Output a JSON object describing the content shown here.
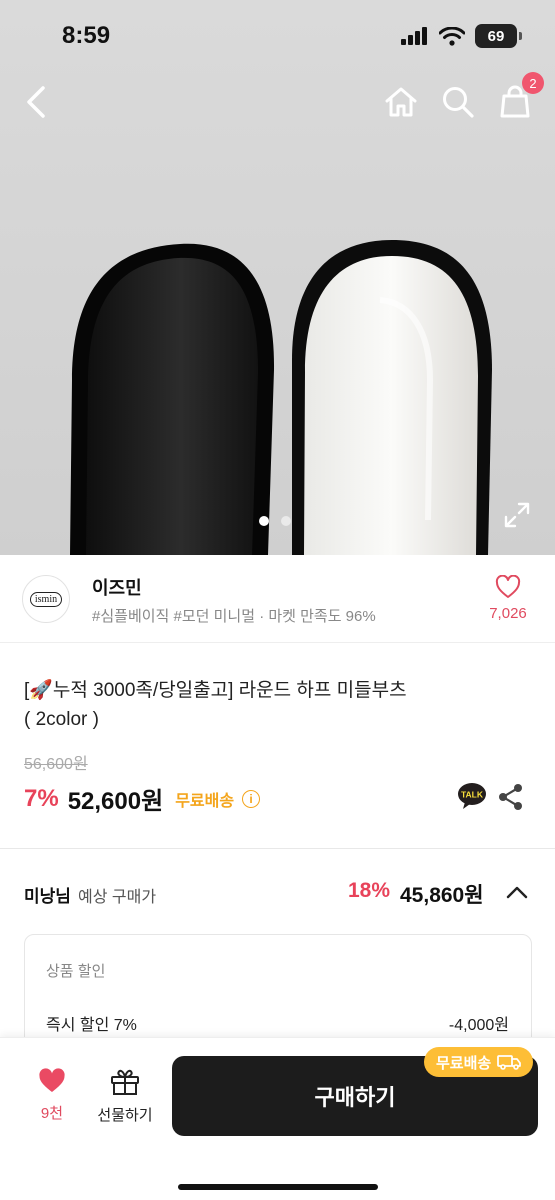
{
  "status": {
    "time": "8:59",
    "battery": "69"
  },
  "header": {
    "cart_count": "2",
    "back_icon": "chevron-left-icon",
    "home_icon": "home-icon",
    "search_icon": "search-icon",
    "cart_icon": "shopping-bag-icon"
  },
  "gallery": {
    "current_index": 1,
    "total": 2
  },
  "shop": {
    "logo_text": "ismin",
    "name": "이즈민",
    "tags": "#심플베이직 #모던 미니멀 · 마켓 만족도 96%",
    "favorite_count": "7,026"
  },
  "product": {
    "title_line1": "[🚀누적 3000족/당일출고] 라운드 하프 미들부츠",
    "title_line2": "( 2color )",
    "original_price": "56,600원",
    "discount": "7%",
    "price": "52,600원",
    "free_shipping": "무료배송",
    "talk_label": "TALK"
  },
  "member": {
    "name": "미낭님",
    "label": "예상 구매가",
    "discount": "18%",
    "price": "45,860원"
  },
  "breakdown": {
    "title": "상품 할인",
    "items": [
      {
        "label": "즉시 할인 7%",
        "value": "-4,000원"
      }
    ]
  },
  "bottom": {
    "like_count": "9천",
    "gift_label": "선물하기",
    "buy_label": "구매하기",
    "shipping_chip": "무료배송"
  },
  "colors": {
    "accent_red": "#e8435a",
    "accent_yellow": "#fdbe36",
    "buy_button": "#1c1c1c"
  }
}
